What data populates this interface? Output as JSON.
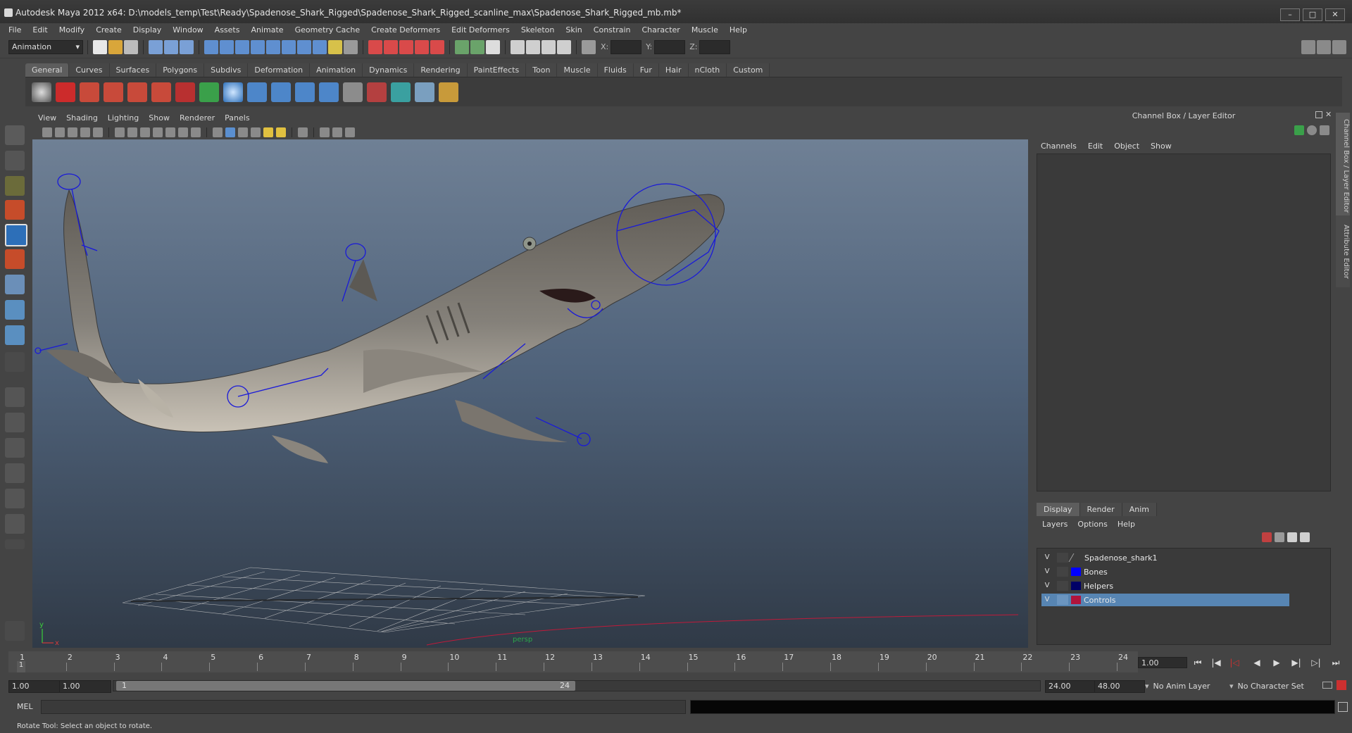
{
  "window": {
    "title": "Autodesk Maya 2012 x64: D:\\models_temp\\Test\\Ready\\Spadenose_Shark_Rigged\\Spadenose_Shark_Rigged_scanline_max\\Spadenose_Shark_Rigged_mb.mb*",
    "controls": [
      "–",
      "□",
      "✕"
    ]
  },
  "menubar": {
    "items": [
      "File",
      "Edit",
      "Modify",
      "Create",
      "Display",
      "Window",
      "Assets",
      "Animate",
      "Geometry Cache",
      "Create Deformers",
      "Edit Deformers",
      "Skeleton",
      "Skin",
      "Constrain",
      "Character",
      "Muscle",
      "Help"
    ]
  },
  "statusline": {
    "menu_set": "Animation",
    "coord_labels": [
      "X:",
      "Y:",
      "Z:"
    ]
  },
  "shelf": {
    "tabs": [
      "General",
      "Curves",
      "Surfaces",
      "Polygons",
      "Subdivs",
      "Deformation",
      "Animation",
      "Dynamics",
      "Rendering",
      "PaintEffects",
      "Toon",
      "Muscle",
      "Fluids",
      "Fur",
      "Hair",
      "nCloth",
      "Custom"
    ],
    "active_tab": "General",
    "icon_count_note": ""
  },
  "viewport": {
    "menu": [
      "View",
      "Shading",
      "Lighting",
      "Show",
      "Renderer",
      "Panels"
    ],
    "camera_label": "persp",
    "axis_y": "y",
    "axis_x": "x"
  },
  "channelbox": {
    "title": "Channel Box / Layer Editor",
    "menu": [
      "Channels",
      "Edit",
      "Object",
      "Show"
    ],
    "side_tabs": [
      "Channel Box / Layer Editor",
      "Attribute Editor"
    ]
  },
  "layers": {
    "tabs": [
      "Display",
      "Render",
      "Anim"
    ],
    "active_tab": "Display",
    "menu": [
      "Layers",
      "Options",
      "Help"
    ],
    "items": [
      {
        "vis": "V",
        "name": "Spadenose_shark1",
        "color": "#3a3a3a",
        "selected": false
      },
      {
        "vis": "V",
        "name": "Bones",
        "color": "#0000ff",
        "selected": false
      },
      {
        "vis": "V",
        "name": "Helpers",
        "color": "#000066",
        "selected": false
      },
      {
        "vis": "V",
        "name": "Controls",
        "color": "#b0143c",
        "selected": true
      }
    ]
  },
  "timeline": {
    "ticks": [
      "1",
      "2",
      "3",
      "4",
      "5",
      "6",
      "7",
      "8",
      "9",
      "10",
      "11",
      "12",
      "13",
      "14",
      "15",
      "16",
      "17",
      "18",
      "19",
      "20",
      "21",
      "22",
      "23",
      "24"
    ],
    "current_marker": "1",
    "current_frame": "1.00",
    "playback_buttons": [
      "⏮",
      "|◀",
      "|◁",
      "◀",
      "▶",
      "▶|",
      "▷|",
      "⏭"
    ]
  },
  "range": {
    "start_time": "1.00",
    "playback_start": "1.00",
    "range_min_label": "1",
    "range_max_label": "24",
    "playback_end": "24.00",
    "end_time": "48.00",
    "anim_layer": "No Anim Layer",
    "character_set": "No Character Set"
  },
  "command": {
    "label": "MEL"
  },
  "helpline": {
    "text": "Rotate Tool: Select an object to rotate."
  }
}
